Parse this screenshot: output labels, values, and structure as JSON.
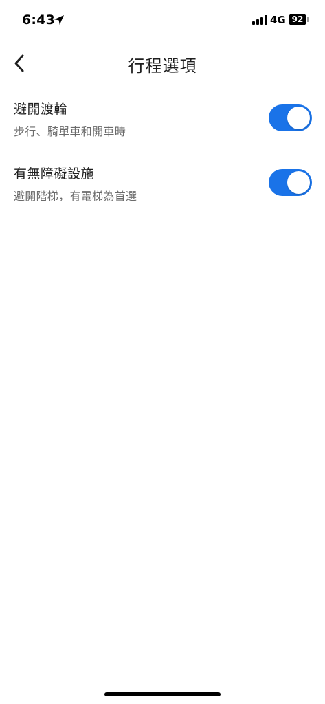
{
  "status_bar": {
    "time": "6:43",
    "network": "4G",
    "battery": "92",
    "location_icon": "location-arrow-icon",
    "signal_icon": "cellular-signal-icon"
  },
  "header": {
    "title": "行程選項",
    "back_icon": "chevron-left-icon"
  },
  "settings": [
    {
      "title": "避開渡輪",
      "subtitle": "步行、騎單車和開車時",
      "enabled": true
    },
    {
      "title": "有無障礙設施",
      "subtitle": "避開階梯，有電梯為首選",
      "enabled": true
    }
  ],
  "colors": {
    "toggle_on": "#1a73e8",
    "background": "#ffffff",
    "text_primary": "#1f1f1f",
    "text_secondary": "#6b6b6b"
  }
}
